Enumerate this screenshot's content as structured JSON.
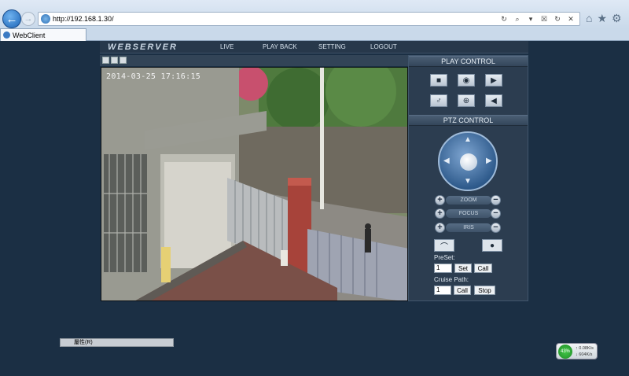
{
  "browser": {
    "url": "http://192.168.1.30/",
    "tab_title": "WebClient",
    "back_glyph": "←",
    "forward_glyph": "→",
    "addr_icons": [
      "↻",
      "⌕",
      "▾",
      "☒",
      "↻",
      "✕"
    ],
    "toolbar_icons": [
      "⌂",
      "★",
      "⚙"
    ]
  },
  "app": {
    "logo": "WEBSERVER",
    "menu": [
      "LIVE",
      "PLAY BACK",
      "SETTING",
      "LOGOUT"
    ]
  },
  "video": {
    "timestamp": "2014-03-25 17:16:15"
  },
  "play_control": {
    "title": "PLAY CONTROL",
    "icons": [
      "stop-icon",
      "snapshot-icon",
      "record-icon",
      "microphone-icon",
      "zoom-icon",
      "speaker-icon"
    ],
    "glyphs": [
      "■",
      "◉",
      "▶",
      "♂",
      "⊕",
      "◀"
    ]
  },
  "ptz_control": {
    "title": "PTZ CONTROL",
    "zoom_label": "ZOOM",
    "focus_label": "FOCUS",
    "iris_label": "IRIS",
    "plus": "+",
    "minus": "−",
    "arrows": {
      "up": "▲",
      "down": "▼",
      "left": "◀",
      "right": "▶"
    },
    "wiper_glyph": "⌒",
    "light_glyph": "●",
    "preset_label": "PreSet:",
    "preset_value": "1",
    "set_label": "Set",
    "call_label": "Call",
    "cruise_label": "Cruise Path:",
    "cruise_value": "1",
    "cruise_call_label": "Call",
    "stop_label": "Stop"
  },
  "footer": {
    "properties_label": "屬性(R)"
  },
  "net_widget": {
    "percent": "43%",
    "up_rate": "0.08K/s",
    "down_rate": "604K/s",
    "up_glyph": "↑",
    "down_glyph": "↓"
  },
  "colors": {
    "background": "#1b2f44",
    "panel": "#2c3d50",
    "accent": "#2f5b8c"
  }
}
